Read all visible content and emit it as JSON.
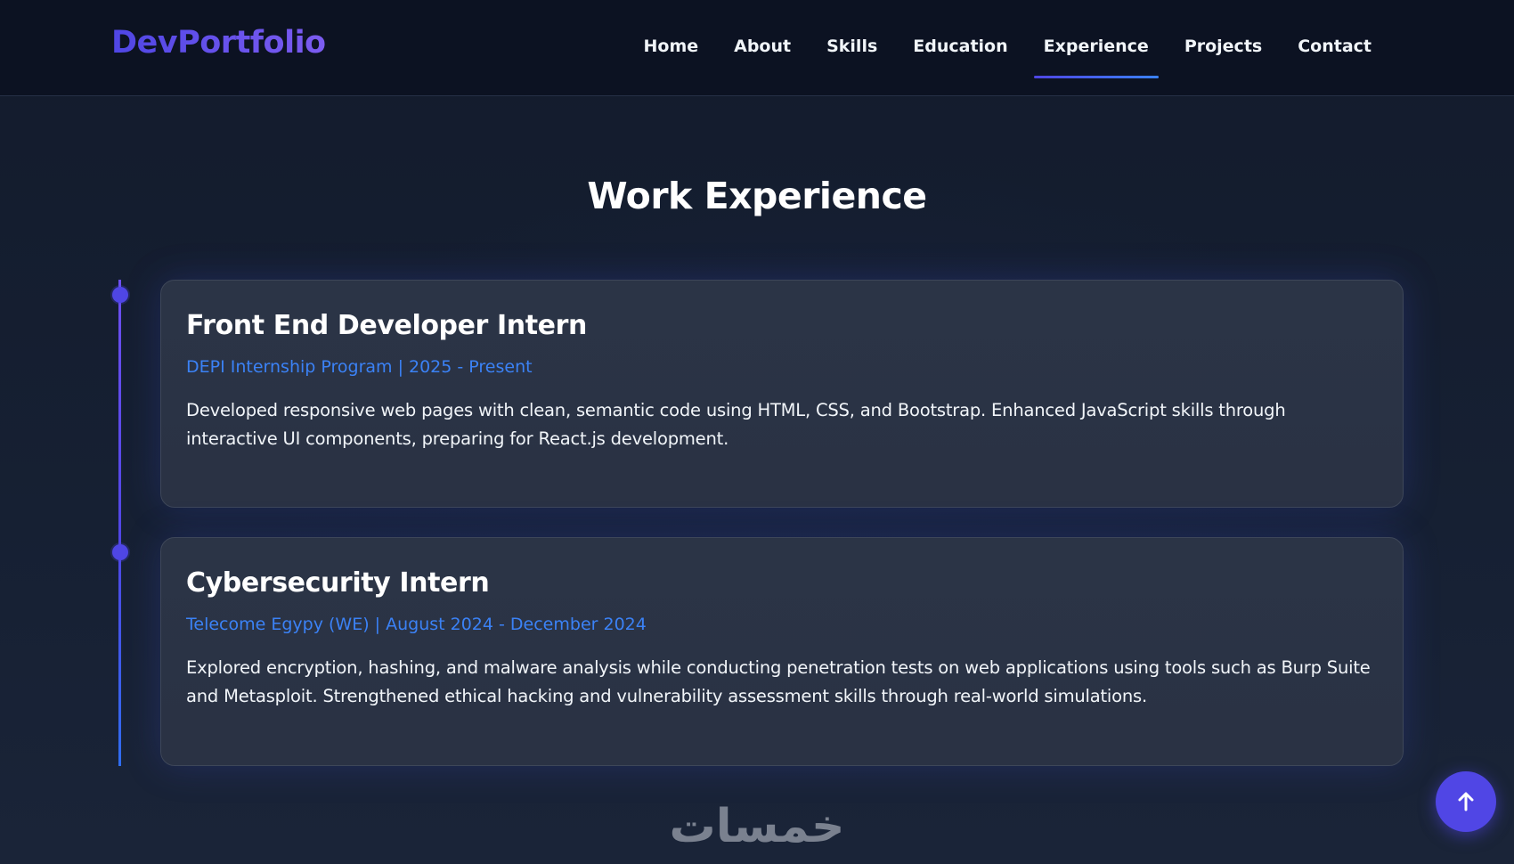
{
  "brand": "DevPortfolio",
  "nav": {
    "items": [
      {
        "label": "Home"
      },
      {
        "label": "About"
      },
      {
        "label": "Skills"
      },
      {
        "label": "Education"
      },
      {
        "label": "Experience",
        "active": true
      },
      {
        "label": "Projects"
      },
      {
        "label": "Contact"
      }
    ]
  },
  "section": {
    "title": "Work Experience"
  },
  "experience": [
    {
      "title": "Front End Developer Intern",
      "meta": "DEPI Internship Program | 2025 - Present",
      "description": "Developed responsive web pages with clean, semantic code using HTML, CSS, and Bootstrap. Enhanced JavaScript skills through interactive UI components, preparing for React.js development."
    },
    {
      "title": "Cybersecurity Intern",
      "meta": "Telecome Egypy (WE) | August 2024 - December 2024",
      "description": "Explored encryption, hashing, and malware analysis while conducting penetration tests on web applications using tools such as Burp Suite and Metasploit. Strengthened ethical hacking and vulnerability assessment skills through real-world simulations."
    }
  ],
  "watermark": "خمسات",
  "back_to_top_icon": "arrow-up-icon",
  "colors": {
    "accent": "#4f46e5",
    "link_blue": "#3b82f6",
    "background": "#141d2f"
  }
}
